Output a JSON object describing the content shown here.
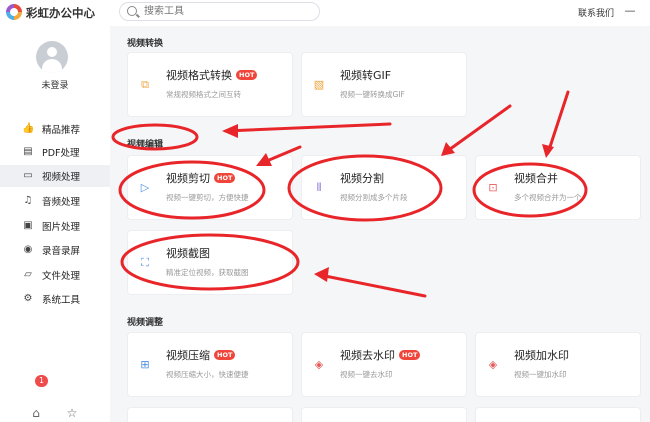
{
  "app": {
    "title": "彩虹办公中心",
    "contact": "联系我们",
    "minimize_glyph": "—"
  },
  "search": {
    "placeholder": "搜索工具"
  },
  "user": {
    "status": "未登录"
  },
  "sidebar": {
    "items": [
      {
        "label": "精品推荐",
        "icon": "thumbs-up-icon",
        "glyph": "👍"
      },
      {
        "label": "PDF处理",
        "icon": "pdf-icon",
        "glyph": "▤"
      },
      {
        "label": "视频处理",
        "icon": "video-icon",
        "glyph": "▭"
      },
      {
        "label": "音频处理",
        "icon": "music-note-icon",
        "glyph": "♫"
      },
      {
        "label": "图片处理",
        "icon": "image-icon",
        "glyph": "▣"
      },
      {
        "label": "录音录屏",
        "icon": "microphone-icon",
        "glyph": "◉"
      },
      {
        "label": "文件处理",
        "icon": "folder-icon",
        "glyph": "▱"
      },
      {
        "label": "系统工具",
        "icon": "gear-icon",
        "glyph": "⚙"
      }
    ],
    "active_index": 2,
    "bottom": {
      "badge_count": "1",
      "left_icon": "home-icon",
      "right_icon": "star-icon"
    }
  },
  "hot_label": "HOT",
  "sections": {
    "convert": {
      "title": "视频转换",
      "cards": [
        {
          "title": "视频格式转换",
          "desc": "常规视频格式之间互转",
          "hot": true,
          "icon": "format-convert-icon"
        },
        {
          "title": "视频转GIF",
          "desc": "视频一键转换成GIF",
          "hot": false,
          "icon": "gif-icon"
        }
      ]
    },
    "edit": {
      "title": "视频编辑",
      "cards": [
        {
          "title": "视频剪切",
          "desc": "视频一键剪切，方便快捷",
          "hot": true,
          "icon": "video-cut-icon"
        },
        {
          "title": "视频分割",
          "desc": "视频分割成多个片段",
          "hot": false,
          "icon": "video-split-icon"
        },
        {
          "title": "视频合并",
          "desc": "多个视频合并为一个",
          "hot": false,
          "icon": "video-merge-icon"
        },
        {
          "title": "视频截图",
          "desc": "精准定位视频，获取截图",
          "hot": false,
          "icon": "screenshot-icon"
        }
      ]
    },
    "adjust": {
      "title": "视频调整",
      "cards": [
        {
          "title": "视频压缩",
          "desc": "视频压缩大小，快速便捷",
          "hot": true,
          "icon": "compress-icon"
        },
        {
          "title": "视频去水印",
          "desc": "视频一键去水印",
          "hot": true,
          "icon": "remove-watermark-icon"
        },
        {
          "title": "视频加水印",
          "desc": "视频一键加水印",
          "hot": false,
          "icon": "add-watermark-icon"
        }
      ]
    }
  },
  "colors": {
    "accent": "#f0453a",
    "annotation": "#e8262a",
    "sidebar_active": "#eef0f4"
  }
}
